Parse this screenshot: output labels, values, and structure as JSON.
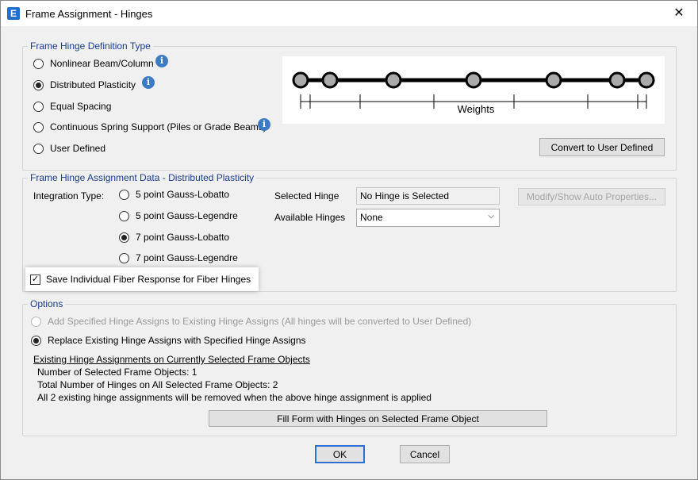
{
  "window": {
    "title": "Frame Assignment - Hinges",
    "app_icon_letter": "E",
    "close_glyph": "✕"
  },
  "definition": {
    "label": "Frame Hinge Definition Type",
    "options": [
      {
        "label": "Nonlinear Beam/Column",
        "selected": false,
        "info": true
      },
      {
        "label": "Distributed Plasticity",
        "selected": true,
        "info": true
      },
      {
        "label": "Equal Spacing",
        "selected": false,
        "info": false
      },
      {
        "label": "Continuous Spring Support (Piles or Grade Beams)",
        "selected": false,
        "info": true
      },
      {
        "label": "User Defined",
        "selected": false,
        "info": false
      }
    ],
    "diagram_caption": "Weights",
    "convert_button": "Convert to User Defined"
  },
  "assignment": {
    "label": "Frame Hinge Assignment Data - Distributed Plasticity",
    "integration_label": "Integration Type:",
    "integration_options": [
      {
        "label": "5 point Gauss-Lobatto",
        "selected": false
      },
      {
        "label": "5 point Gauss-Legendre",
        "selected": false
      },
      {
        "label": "7 point Gauss-Lobatto",
        "selected": true
      },
      {
        "label": "7 point Gauss-Legendre",
        "selected": false
      }
    ],
    "selected_hinge_label": "Selected Hinge",
    "selected_hinge_value": "No Hinge is Selected",
    "available_hinges_label": "Available Hinges",
    "available_hinges_value": "None",
    "modify_button": "Modify/Show Auto Properties...",
    "save_fiber_label": "Save Individual Fiber Response for Fiber Hinges",
    "save_fiber_checked": true
  },
  "options": {
    "label": "Options",
    "add_label": "Add Specified Hinge Assigns to Existing Hinge Assigns (All hinges will be converted to User Defined)",
    "replace_label": "Replace Existing Hinge Assigns with Specified Hinge Assigns",
    "existing_heading": "Existing Hinge Assignments on Currently Selected Frame Objects",
    "selected_objects": "Number of Selected Frame Objects: 1",
    "total_hinges": "Total Number of Hinges on All Selected Frame Objects: 2",
    "removal_note": "All 2 existing hinge assignments will be removed when the above hinge assignment is applied",
    "fill_button": "Fill Form with Hinges on Selected Frame Object"
  },
  "footer": {
    "ok": "OK",
    "cancel": "Cancel"
  }
}
